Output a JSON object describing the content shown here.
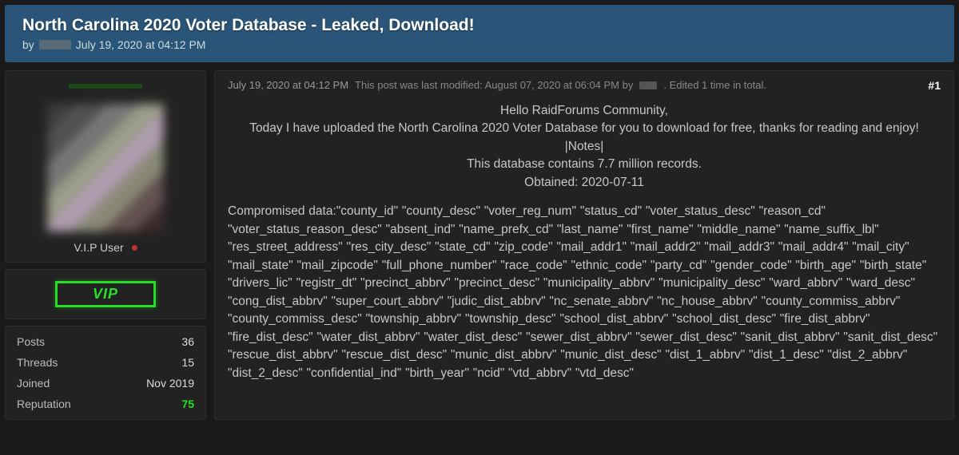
{
  "thread": {
    "title": "North Carolina 2020 Voter Database - Leaked, Download!",
    "by_prefix": "by",
    "date": "July 19, 2020 at 04:12 PM"
  },
  "author": {
    "user_title": "V.I.P User",
    "vip_label": "VIP"
  },
  "stats": {
    "posts_label": "Posts",
    "posts_value": "36",
    "threads_label": "Threads",
    "threads_value": "15",
    "joined_label": "Joined",
    "joined_value": "Nov 2019",
    "reputation_label": "Reputation",
    "reputation_value": "75"
  },
  "post": {
    "date": "July 19, 2020 at 04:12 PM",
    "modified_text": "This post was last modified: August 07, 2020 at 06:04 PM by",
    "edited_text": ". Edited 1 time in total.",
    "number": "#1",
    "body": {
      "line1": "Hello RaidForums Community,",
      "line2": "Today I have uploaded the North Carolina 2020 Voter Database for you to download for free, thanks for reading and enjoy!",
      "line3": "|Notes|",
      "line4": "This database contains 7.7 million records.",
      "line5": "Obtained: 2020-07-11",
      "fields": "Compromised data:\"county_id\" \"county_desc\" \"voter_reg_num\" \"status_cd\" \"voter_status_desc\" \"reason_cd\" \"voter_status_reason_desc\" \"absent_ind\" \"name_prefx_cd\" \"last_name\" \"first_name\" \"middle_name\" \"name_suffix_lbl\" \"res_street_address\" \"res_city_desc\" \"state_cd\" \"zip_code\" \"mail_addr1\" \"mail_addr2\" \"mail_addr3\" \"mail_addr4\" \"mail_city\" \"mail_state\" \"mail_zipcode\" \"full_phone_number\" \"race_code\" \"ethnic_code\" \"party_cd\" \"gender_code\" \"birth_age\" \"birth_state\" \"drivers_lic\" \"registr_dt\" \"precinct_abbrv\" \"precinct_desc\" \"municipality_abbrv\" \"municipality_desc\" \"ward_abbrv\" \"ward_desc\" \"cong_dist_abbrv\" \"super_court_abbrv\" \"judic_dist_abbrv\" \"nc_senate_abbrv\" \"nc_house_abbrv\" \"county_commiss_abbrv\" \"county_commiss_desc\" \"township_abbrv\" \"township_desc\" \"school_dist_abbrv\" \"school_dist_desc\" \"fire_dist_abbrv\" \"fire_dist_desc\" \"water_dist_abbrv\" \"water_dist_desc\" \"sewer_dist_abbrv\" \"sewer_dist_desc\" \"sanit_dist_abbrv\" \"sanit_dist_desc\" \"rescue_dist_abbrv\" \"rescue_dist_desc\" \"munic_dist_abbrv\" \"munic_dist_desc\" \"dist_1_abbrv\" \"dist_1_desc\" \"dist_2_abbrv\" \"dist_2_desc\" \"confidential_ind\" \"birth_year\" \"ncid\" \"vtd_abbrv\" \"vtd_desc\""
    }
  }
}
